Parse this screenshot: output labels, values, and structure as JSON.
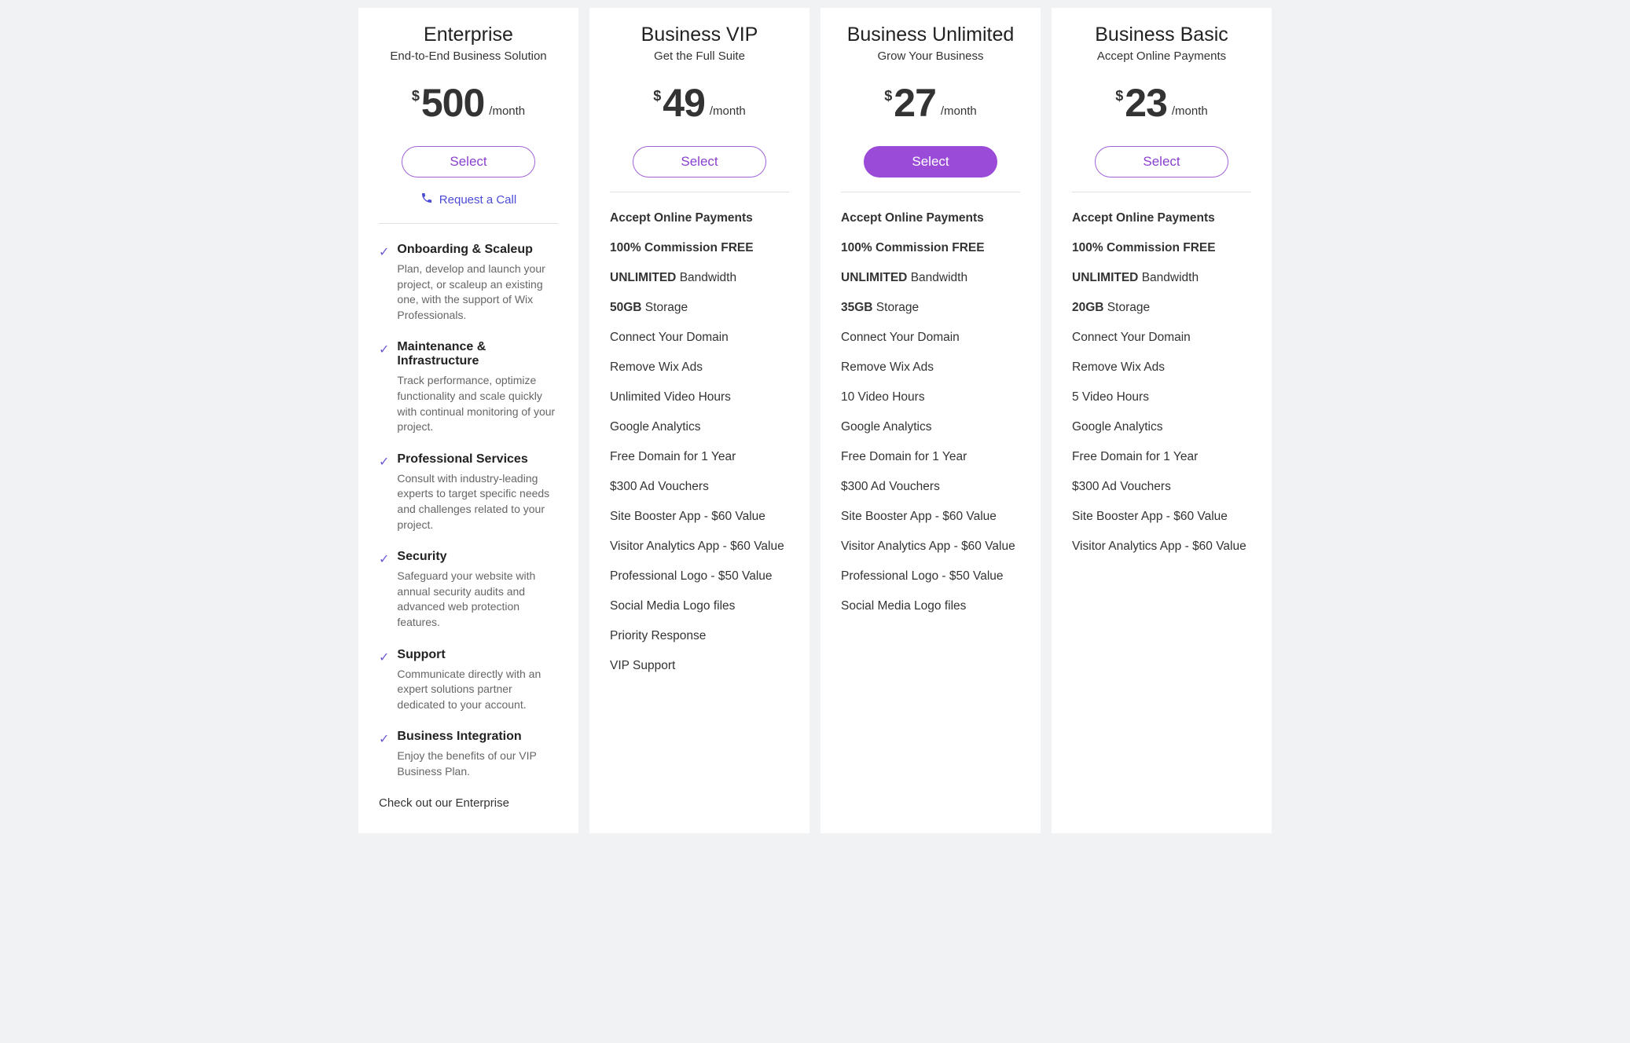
{
  "plans": [
    {
      "title": "Enterprise",
      "subtitle": "End-to-End Business Solution",
      "currency": "$",
      "price": "500",
      "period": "/month",
      "select": "Select",
      "call": "Request a Call",
      "items": [
        {
          "heading": "Onboarding & Scaleup",
          "desc": "Plan, develop and launch your project, or scaleup an existing one, with the support of Wix Professionals."
        },
        {
          "heading": "Maintenance & Infrastructure",
          "desc": "Track performance, optimize functionality and scale quickly with continual monitoring of your project."
        },
        {
          "heading": "Professional Services",
          "desc": "Consult with industry-leading experts to target specific needs and challenges related to your project."
        },
        {
          "heading": "Security",
          "desc": "Safeguard your website with annual security audits and advanced web protection features."
        },
        {
          "heading": "Support",
          "desc": "Communicate directly with an expert solutions partner dedicated to your account."
        },
        {
          "heading": "Business Integration",
          "desc": "Enjoy the benefits of our VIP Business Plan."
        }
      ],
      "footer": "Check out our Enterprise"
    },
    {
      "title": "Business VIP",
      "subtitle": "Get the Full Suite",
      "currency": "$",
      "price": "49",
      "period": "/month",
      "select": "Select",
      "boldFeatures": [
        {
          "bold": "Accept Online Payments",
          "rest": ""
        },
        {
          "bold": "100% Commission FREE",
          "rest": ""
        },
        {
          "bold": "UNLIMITED",
          "rest": " Bandwidth"
        },
        {
          "bold": "50GB",
          "rest": " Storage"
        }
      ],
      "features": [
        "Connect Your Domain",
        "Remove Wix Ads",
        "Unlimited Video Hours",
        "Google Analytics",
        "Free Domain for 1 Year",
        "$300 Ad Vouchers",
        "Site Booster App - $60 Value",
        "Visitor Analytics App - $60 Value",
        "Professional Logo - $50 Value",
        "Social Media Logo files",
        "Priority Response",
        "VIP Support"
      ]
    },
    {
      "title": "Business Unlimited",
      "subtitle": "Grow Your Business",
      "currency": "$",
      "price": "27",
      "period": "/month",
      "select": "Select",
      "highlighted": true,
      "boldFeatures": [
        {
          "bold": "Accept Online Payments",
          "rest": ""
        },
        {
          "bold": "100% Commission FREE",
          "rest": ""
        },
        {
          "bold": "UNLIMITED",
          "rest": " Bandwidth"
        },
        {
          "bold": "35GB",
          "rest": " Storage"
        }
      ],
      "features": [
        "Connect Your Domain",
        "Remove Wix Ads",
        "10 Video Hours",
        "Google Analytics",
        "Free Domain for 1 Year",
        "$300 Ad Vouchers",
        "Site Booster App - $60 Value",
        "Visitor Analytics App - $60 Value",
        "Professional Logo - $50 Value",
        "Social Media Logo files"
      ]
    },
    {
      "title": "Business Basic",
      "subtitle": "Accept Online Payments",
      "currency": "$",
      "price": "23",
      "period": "/month",
      "select": "Select",
      "boldFeatures": [
        {
          "bold": "Accept Online Payments",
          "rest": ""
        },
        {
          "bold": "100% Commission FREE",
          "rest": ""
        },
        {
          "bold": "UNLIMITED",
          "rest": " Bandwidth"
        },
        {
          "bold": "20GB",
          "rest": " Storage"
        }
      ],
      "features": [
        "Connect Your Domain",
        "Remove Wix Ads",
        "5 Video Hours",
        "Google Analytics",
        "Free Domain for 1 Year",
        "$300 Ad Vouchers",
        "Site Booster App - $60 Value",
        "Visitor Analytics App - $60 Value"
      ]
    }
  ]
}
